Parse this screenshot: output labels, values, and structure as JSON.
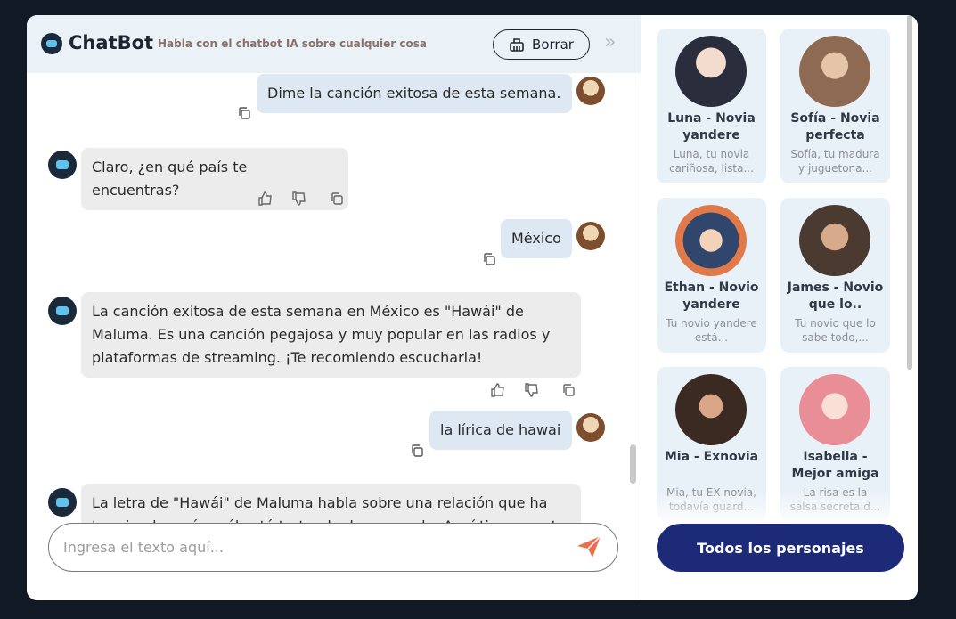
{
  "header": {
    "brand": "ChatBot",
    "tagline": "Habla con el chatbot IA sobre cualquier cosa",
    "clear_label": "Borrar"
  },
  "messages": [
    {
      "role": "user",
      "text": "Dime la canción exitosa de esta semana."
    },
    {
      "role": "bot",
      "text": "Claro, ¿en qué país te encuentras?"
    },
    {
      "role": "user",
      "text": "México"
    },
    {
      "role": "bot",
      "text": "La canción exitosa de esta semana en México es \"Hawái\" de Maluma. Es una canción pegajosa y muy popular en las radios y plataformas de streaming. ¡Te recomiendo escucharla!"
    },
    {
      "role": "user",
      "text": "la lírica de hawai"
    },
    {
      "role": "bot",
      "text": "La letra de \"Hawái\" de Maluma habla sobre una relación que ha terminado y cómo él está tratando de superarla. Aquí tienes parte"
    }
  ],
  "input": {
    "placeholder": "Ingresa el texto aquí..."
  },
  "characters": [
    {
      "name": "Luna - Novia yandere",
      "desc": "Luna, tu novia cariñosa, lista...",
      "icon": "avatar-luna"
    },
    {
      "name": "Sofía - Novia perfecta",
      "desc": "Sofía, tu madura y juguetona...",
      "icon": "avatar-sofia"
    },
    {
      "name": "Ethan - Novio yandere",
      "desc": "Tu novio yandere está...",
      "icon": "avatar-ethan"
    },
    {
      "name": "James - Novio que lo..",
      "desc": "Tu novio que lo sabe todo,...",
      "icon": "avatar-james"
    },
    {
      "name": "Mia - Exnovia",
      "desc": "Mia, tu EX novia, todavía guard...",
      "icon": "avatar-mia"
    },
    {
      "name": "Isabella - Mejor amiga",
      "desc": "La risa es la salsa secreta d...",
      "icon": "avatar-isabella"
    }
  ],
  "all_characters_label": "Todos los personajes",
  "colors": {
    "header_bg": "#eaf2f8",
    "user_bubble": "#dde8f2",
    "bot_bubble": "#ececec",
    "accent_button": "#1c2a78",
    "send_icon": "#e8704e",
    "page_bg": "#101924"
  }
}
